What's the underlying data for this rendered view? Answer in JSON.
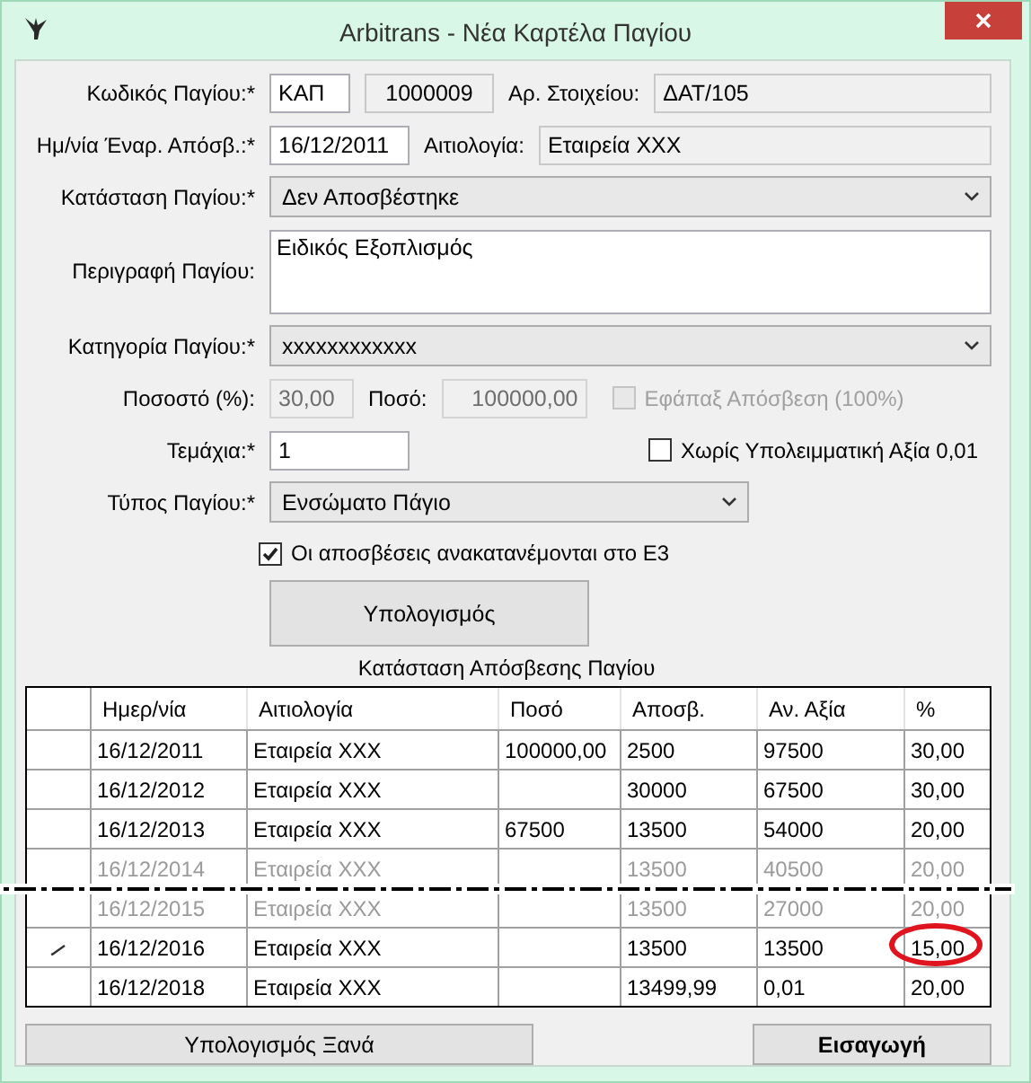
{
  "window": {
    "title": "Arbitrans - Νέα Καρτέλα Παγίου"
  },
  "form": {
    "code_label": "Κωδικός Παγίου:*",
    "code_prefix": "ΚΑΠ",
    "code_number": "1000009",
    "doc_label": "Αρ. Στοιχείου:",
    "doc_value": "ΔΑΤ/105",
    "start_label": "Ημ/νία Έναρ. Απόσβ.:*",
    "start_value": "16/12/2011",
    "reason_label": "Αιτιολογία:",
    "reason_value": "Εταιρεία XXX",
    "status_label": "Κατάσταση Παγίου:*",
    "status_value": "Δεν Αποσβέστηκε",
    "desc_label": "Περιγραφή Παγίου:",
    "desc_value": "Ειδικός Εξοπλισμός",
    "category_label": "Κατηγορία Παγίου:*",
    "category_value": "xxxxxxxxxxxx",
    "percent_label": "Ποσοστό (%):",
    "percent_value": "30,00",
    "amount_label": "Ποσό:",
    "amount_value": "100000,00",
    "lump": {
      "label": "Εφάπαξ Απόσβεση (100%)",
      "checked": false,
      "disabled": true
    },
    "pieces_label": "Τεμάχια:*",
    "pieces_value": "1",
    "no_residual": {
      "label": "Χωρίς Υπολειμματική Αξία 0,01",
      "checked": false,
      "disabled": false
    },
    "type_label": "Τύπος Παγίου:*",
    "type_value": "Ενσώματο Πάγιο",
    "redistribute": {
      "label": "Οι αποσβέσεις ανακατανέμονται στο Ε3",
      "checked": true,
      "disabled": false
    },
    "calc_button": "Υπολογισμός"
  },
  "table": {
    "caption": "Κατάσταση Απόσβεσης Παγίου",
    "columns": [
      "Ημερ/νία",
      "Αιτιολογία",
      "Ποσό",
      "Αποσβ.",
      "Αν. Αξία",
      "%"
    ],
    "rows": [
      {
        "cells": [
          "16/12/2011",
          "Εταιρεία XXX",
          "100000,00",
          "2500",
          "97500",
          "30,00"
        ],
        "faded": false,
        "editing": false,
        "torn_edge": false,
        "percent_circled": false
      },
      {
        "cells": [
          "16/12/2012",
          "Εταιρεία XXX",
          "",
          "30000",
          "67500",
          "30,00"
        ],
        "faded": false,
        "editing": false,
        "torn_edge": false,
        "percent_circled": false
      },
      {
        "cells": [
          "16/12/2013",
          "Εταιρεία XXX",
          "67500",
          "13500",
          "54000",
          "20,00"
        ],
        "faded": false,
        "editing": false,
        "torn_edge": false,
        "percent_circled": false
      },
      {
        "cells": [
          "16/12/2014",
          "Εταιρεία XXX",
          "",
          "13500",
          "40500",
          "20,00"
        ],
        "faded": true,
        "editing": false,
        "torn_edge": true,
        "percent_circled": false
      },
      {
        "cells": [
          "16/12/2015",
          "Εταιρεία XXX",
          "",
          "13500",
          "27000",
          "20,00"
        ],
        "faded": true,
        "editing": false,
        "torn_edge": false,
        "percent_circled": false
      },
      {
        "cells": [
          "16/12/2016",
          "Εταιρεία XXX",
          "",
          "13500",
          "13500",
          "15,00"
        ],
        "faded": false,
        "editing": true,
        "torn_edge": false,
        "percent_circled": true
      },
      {
        "cells": [
          "16/12/2018",
          "Εταιρεία XXX",
          "",
          "13499,99",
          "0,01",
          "20,00"
        ],
        "faded": false,
        "editing": false,
        "torn_edge": false,
        "percent_circled": false
      }
    ]
  },
  "buttons": {
    "recalc": "Υπολογισμός Ξανά",
    "insert": "Εισαγωγή"
  }
}
